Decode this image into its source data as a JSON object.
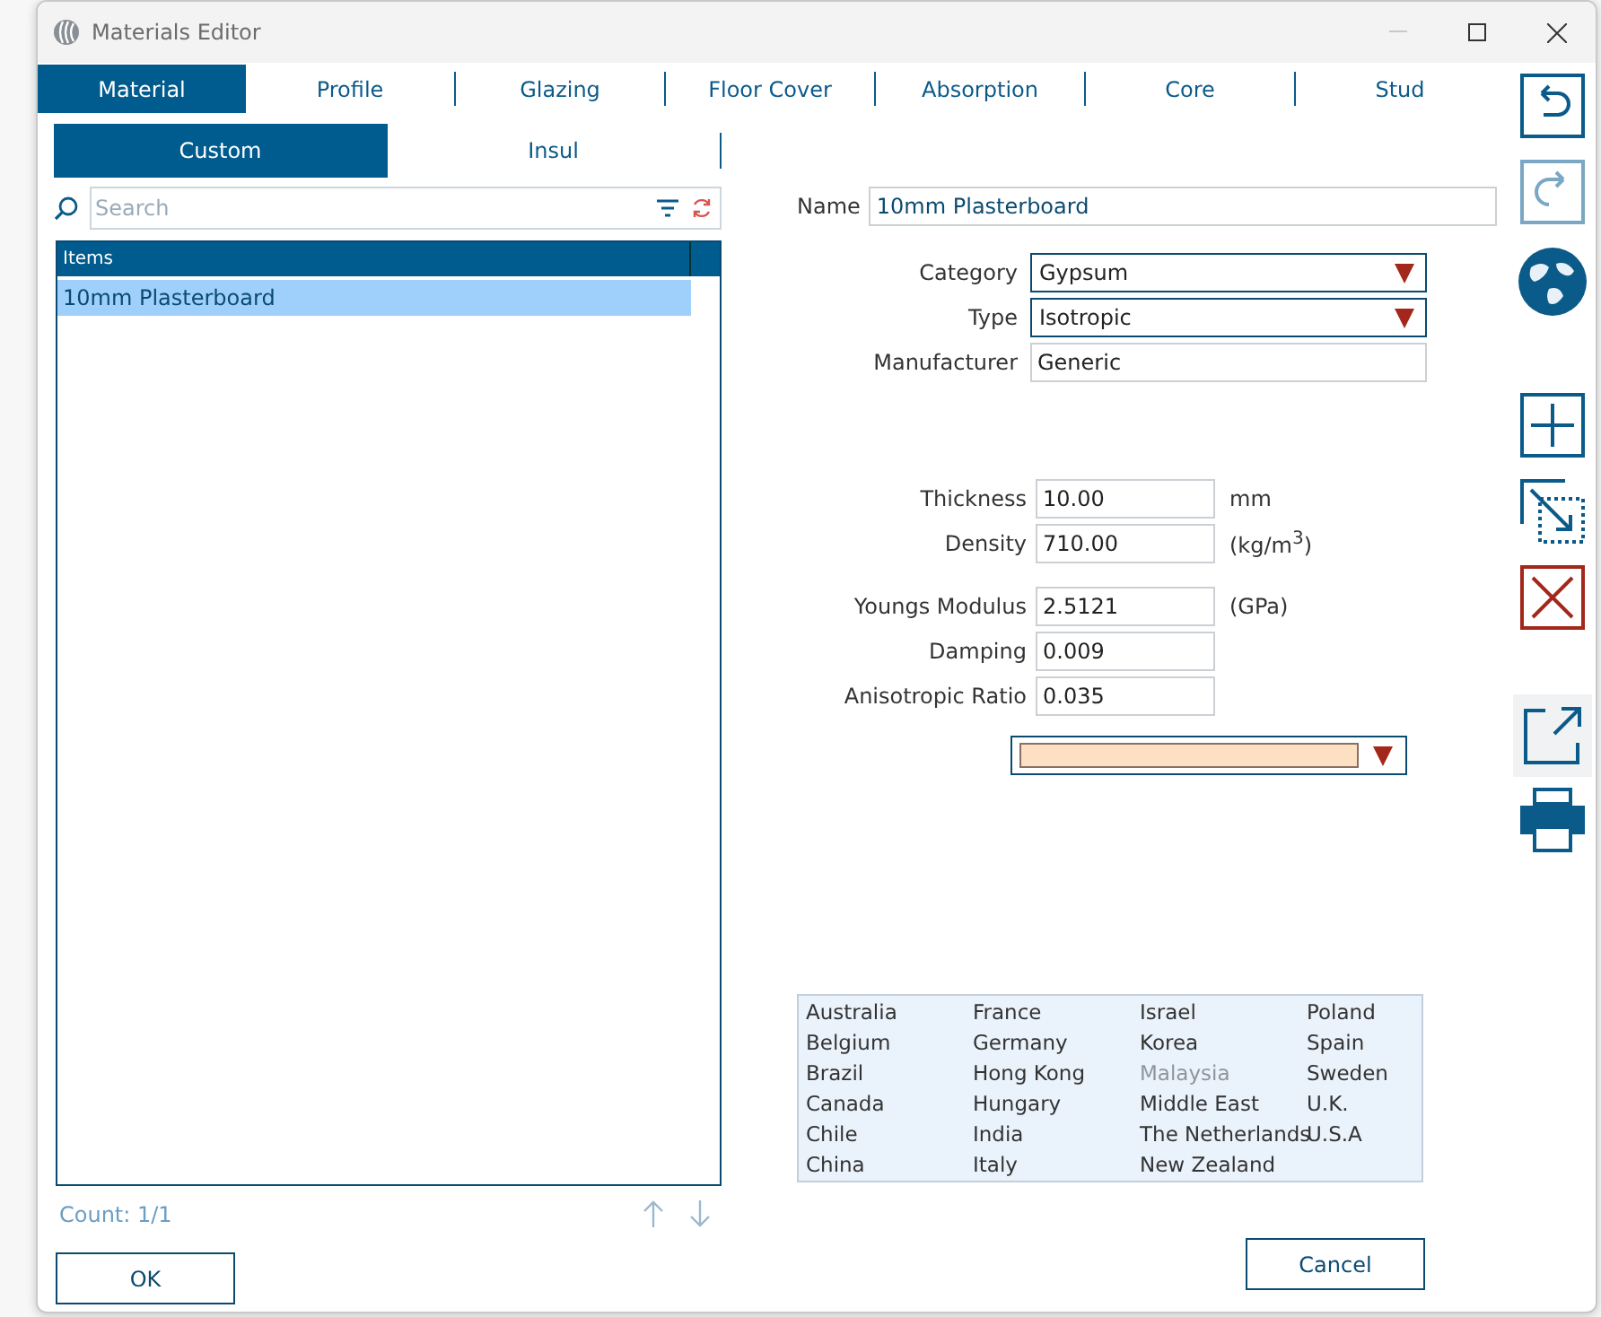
{
  "window": {
    "title": "Materials Editor"
  },
  "tabs": [
    {
      "label": "Material",
      "selected": true
    },
    {
      "label": "Profile",
      "selected": false
    },
    {
      "label": "Glazing",
      "selected": false
    },
    {
      "label": "Floor Cover",
      "selected": false
    },
    {
      "label": "Absorption",
      "selected": false
    },
    {
      "label": "Core",
      "selected": false
    },
    {
      "label": "Stud",
      "selected": false
    }
  ],
  "sub_tabs": [
    {
      "label": "Custom",
      "selected": true
    },
    {
      "label": "Insul",
      "selected": false
    }
  ],
  "search": {
    "placeholder": "Search"
  },
  "items_list": {
    "column": "Items",
    "rows": [
      {
        "label": "10mm Plasterboard",
        "selected": true
      }
    ]
  },
  "count": "Count: 1/1",
  "name_field": {
    "label": "Name",
    "value": "10mm Plasterboard"
  },
  "general_fields": [
    {
      "label": "Category",
      "value": "Gypsum",
      "kind": "combo"
    },
    {
      "label": "Type",
      "value": "Isotropic",
      "kind": "combo"
    },
    {
      "label": "Manufacturer",
      "value": "Generic",
      "kind": "text"
    }
  ],
  "physical_fields": [
    {
      "label": "Thickness",
      "value": "10.00",
      "unit": "mm"
    },
    {
      "label": "Density",
      "value": "710.00",
      "unit": "(kg/m$^{3}$)"
    }
  ],
  "mechanical_fields": [
    {
      "label": "Youngs Modulus",
      "value": "2.5121",
      "unit": "(GPa)"
    },
    {
      "label": "Damping",
      "value": "0.009"
    },
    {
      "label": "Anisotropic Ratio",
      "value": "0.035"
    }
  ],
  "countries": [
    {
      "label": "Australia",
      "disabled": false
    },
    {
      "label": "Belgium",
      "disabled": false
    },
    {
      "label": "Brazil",
      "disabled": false
    },
    {
      "label": "Canada",
      "disabled": false
    },
    {
      "label": "Chile",
      "disabled": false
    },
    {
      "label": "China",
      "disabled": false
    },
    {
      "label": "France",
      "disabled": false
    },
    {
      "label": "Germany",
      "disabled": false
    },
    {
      "label": "Hong Kong",
      "disabled": false
    },
    {
      "label": "Hungary",
      "disabled": false
    },
    {
      "label": "India",
      "disabled": false
    },
    {
      "label": "Italy",
      "disabled": false
    },
    {
      "label": "Israel",
      "disabled": false
    },
    {
      "label": "Korea",
      "disabled": false
    },
    {
      "label": "Malaysia",
      "disabled": true
    },
    {
      "label": "Middle East",
      "disabled": false
    },
    {
      "label": "The Netherlands",
      "disabled": false
    },
    {
      "label": "New Zealand",
      "disabled": false
    },
    {
      "label": "Poland",
      "disabled": false
    },
    {
      "label": "Spain",
      "disabled": false
    },
    {
      "label": "Sweden",
      "disabled": false
    },
    {
      "label": "U.K.",
      "disabled": false
    },
    {
      "label": "U.S.A",
      "disabled": false
    }
  ],
  "buttons": {
    "ok": "OK",
    "cancel": "Cancel"
  }
}
